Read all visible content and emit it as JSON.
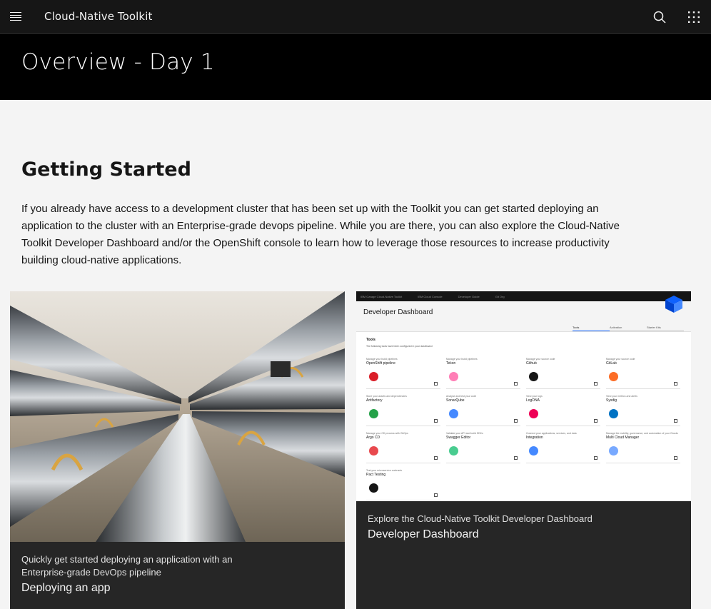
{
  "header": {
    "app_title": "Cloud-Native Toolkit",
    "icons": [
      "menu-icon",
      "search-icon",
      "app-switcher-icon"
    ]
  },
  "hero": {
    "title": "Overview - Day 1"
  },
  "main": {
    "section_title": "Getting Started",
    "intro": "If you already have access to a development cluster that has been set up with the Toolkit you can get started deploying an application to the cluster with an Enterprise-grade devops pipeline. While you are there, you can also explore the Cloud-Native Toolkit Developer Dashboard and/or the OpenShift console to learn how to leverage those resources to increase productivity building cloud-native applications."
  },
  "cards": [
    {
      "subtitle": "Quickly get started deploying an application with an Enterprise-grade DevOps pipeline",
      "title": "Deploying an app"
    },
    {
      "subtitle": "Explore the Cloud-Native Toolkit Developer Dashboard",
      "title": "Developer Dashboard"
    }
  ],
  "dashboard_preview": {
    "nav": [
      "IBM Garage Cloud-Native Toolkit",
      "IBM Cloud Console",
      "Developer Guide",
      "Git Org"
    ],
    "title": "Developer Dashboard",
    "tabs": [
      "Tools",
      "Activation",
      "Starter Kits"
    ],
    "section": "Tools",
    "section_desc": "The following tools have been configured in your dashboard",
    "tools": [
      {
        "desc": "Manage your build pipelines",
        "name": "OpenShift pipeline",
        "color": "#da1e28"
      },
      {
        "desc": "Manage your build pipelines",
        "name": "Tekon",
        "color": "#ff7eb6"
      },
      {
        "desc": "Manage your source code",
        "name": "Github",
        "color": "#161616"
      },
      {
        "desc": "Manage your source code",
        "name": "GitLab",
        "color": "#fc6d26"
      },
      {
        "desc": "Store your assets and dependencies",
        "name": "Artifactory",
        "color": "#24a148"
      },
      {
        "desc": "Analyse and test your code",
        "name": "SonarQube",
        "color": "#4589ff"
      },
      {
        "desc": "View your logs",
        "name": "LogDNA",
        "color": "#ee0055"
      },
      {
        "desc": "View your metrics and alerts",
        "name": "Sysdig",
        "color": "#0072c3"
      },
      {
        "desc": "Manage your CD process with GitOps",
        "name": "Argo CD",
        "color": "#e8494e"
      },
      {
        "desc": "Validate your API and build SDKs",
        "name": "Swagger Editor",
        "color": "#49cc90"
      },
      {
        "desc": "Connect your applications, services, and data",
        "name": "Integration",
        "color": "#4589ff"
      },
      {
        "desc": "Manage the mobility, governance, and automation of your Clouds",
        "name": "Multi Cloud Manager",
        "color": "#78a9ff"
      },
      {
        "desc": "Test your microservice contracts",
        "name": "Pact Testing",
        "color": "#161616"
      }
    ]
  }
}
